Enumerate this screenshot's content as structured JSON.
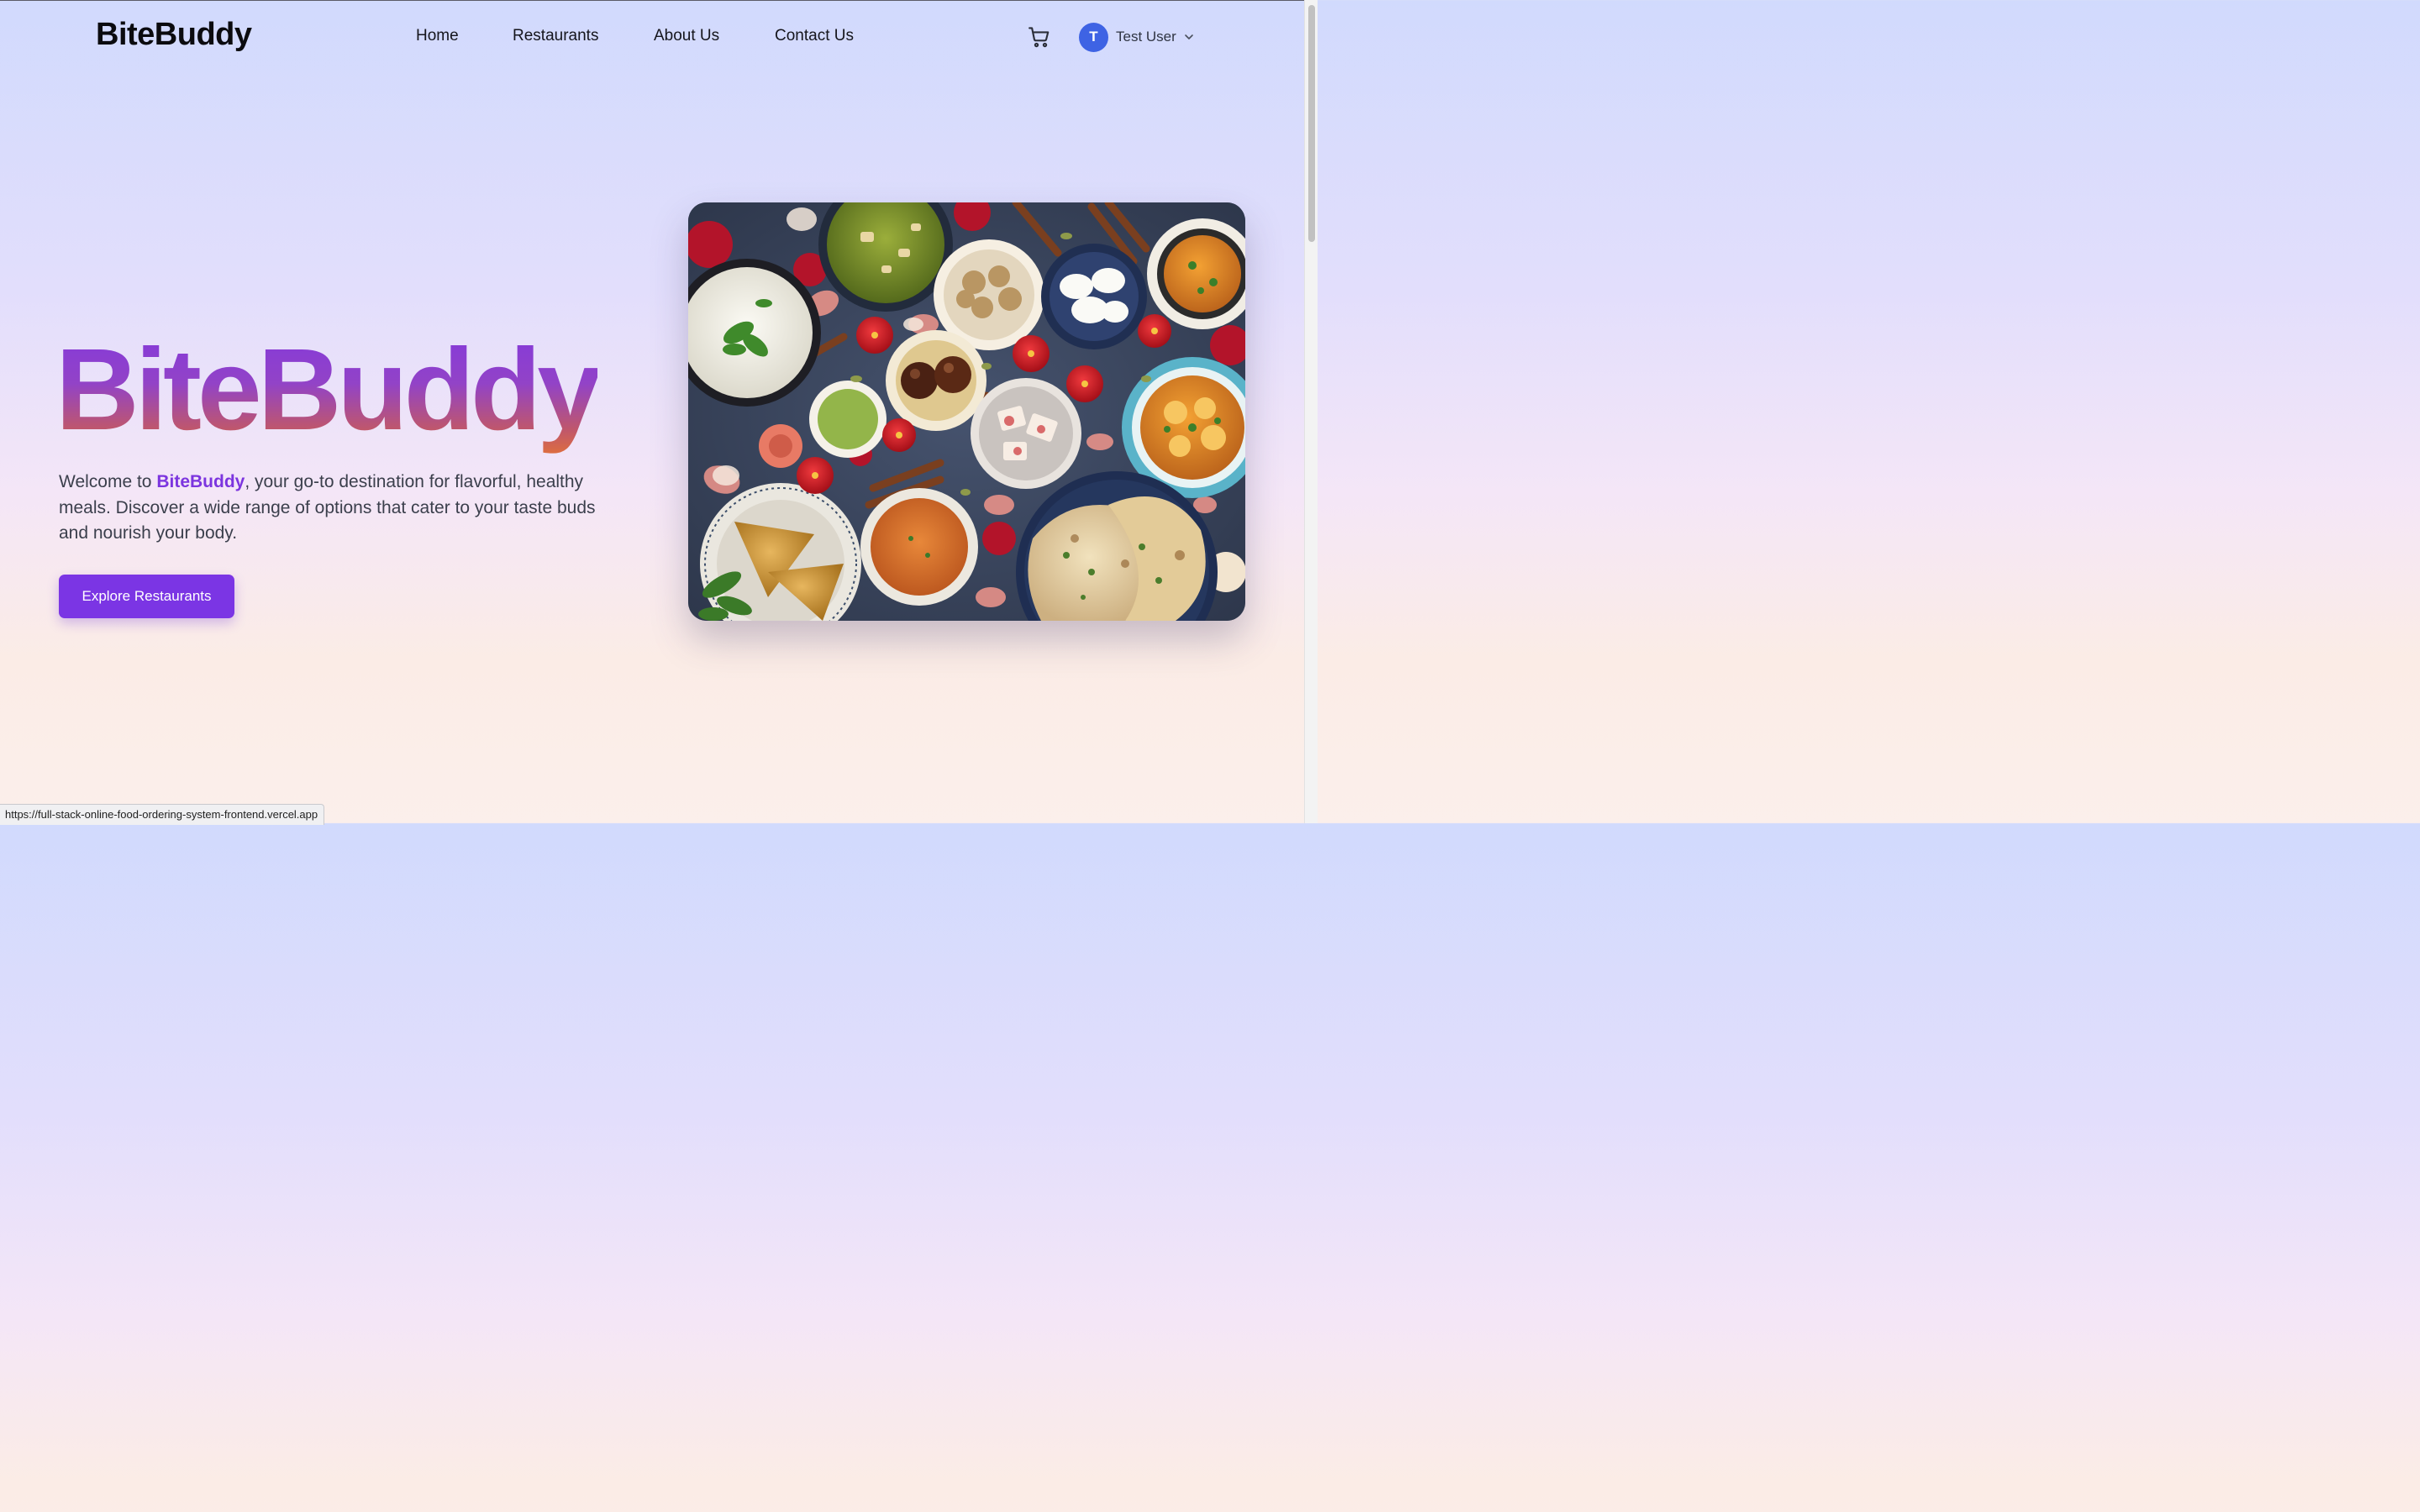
{
  "header": {
    "brand": "BiteBuddy",
    "nav": [
      {
        "label": "Home"
      },
      {
        "label": "Restaurants"
      },
      {
        "label": "About Us"
      },
      {
        "label": "Contact Us"
      }
    ],
    "cart_icon": "shopping-cart-icon",
    "user": {
      "initial": "T",
      "name": "Test User",
      "avatar_color": "#3e63e4",
      "menu_icon": "chevron-down-icon"
    }
  },
  "hero": {
    "title": "BiteBuddy",
    "description_prefix": "Welcome to ",
    "description_highlight": "BiteBuddy",
    "description_suffix": ", your go-to destination for flavorful, healthy meals. Discover a wide range of options that cater to your taste buds and nourish your body.",
    "cta_label": "Explore Restaurants",
    "image_subject": "overhead spread of Indian dishes"
  },
  "theme": {
    "accent": "#7b35e4",
    "title_gradient_start": "#8338dd",
    "title_gradient_end": "#e1703a"
  },
  "status_bar": {
    "url": "https://full-stack-online-food-ordering-system-frontend.vercel.app"
  }
}
